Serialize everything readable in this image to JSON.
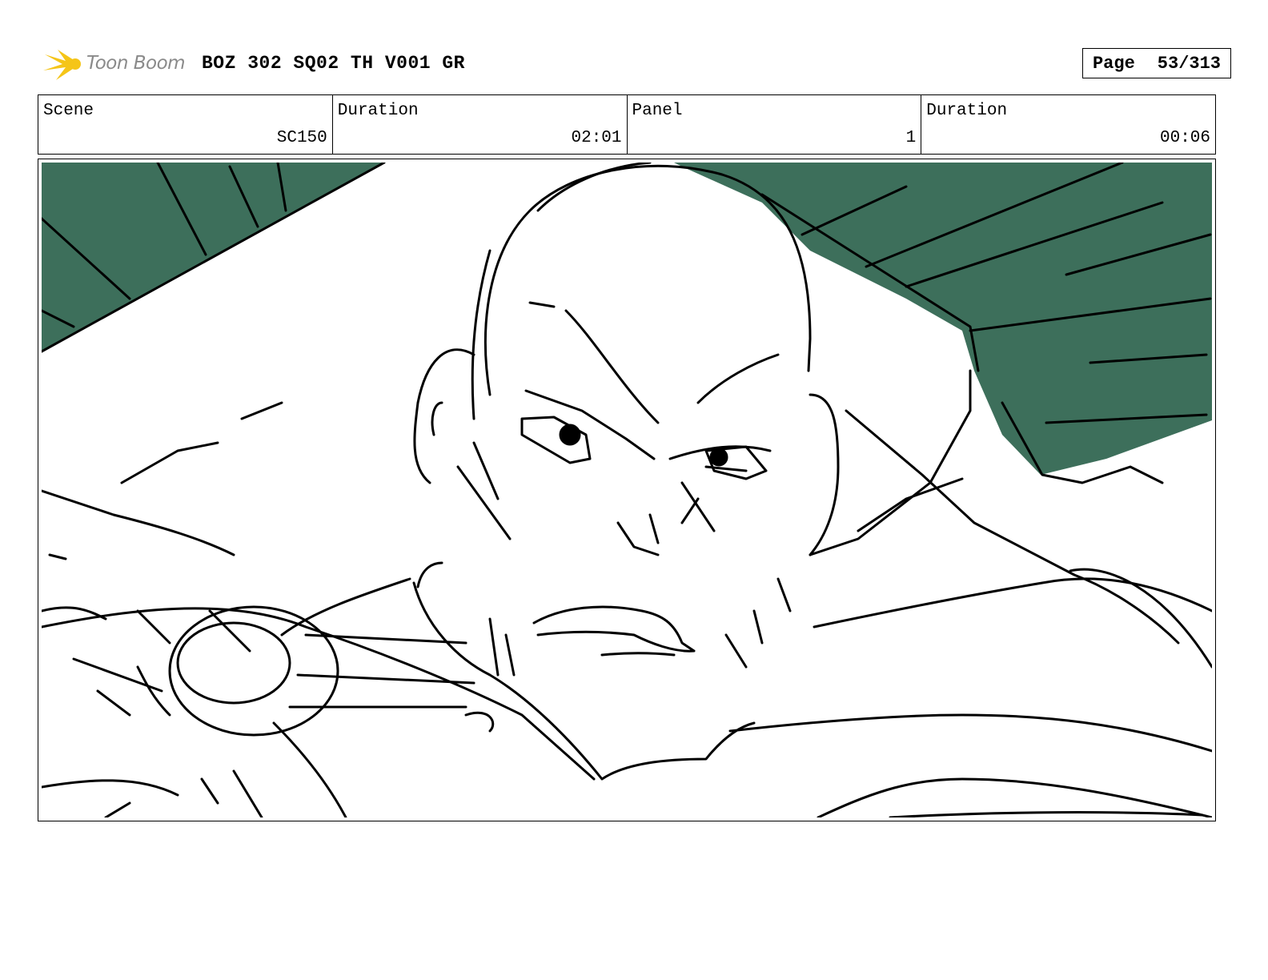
{
  "header": {
    "logo_text": "Toon Boom",
    "title": "BOZ 302 SQ02 TH V001 GR",
    "page_label": "Page",
    "page_value": "53/313"
  },
  "info": {
    "scene_label": "Scene",
    "scene_value": "SC150",
    "duration_label": "Duration",
    "duration_value": "02:01",
    "panel_label": "Panel",
    "panel_value": "1",
    "panel_duration_label": "Duration",
    "panel_duration_value": "00:06"
  },
  "colors": {
    "background_green": "#3d6f5b",
    "logo_yellow": "#f5c518",
    "ink": "#000000"
  }
}
